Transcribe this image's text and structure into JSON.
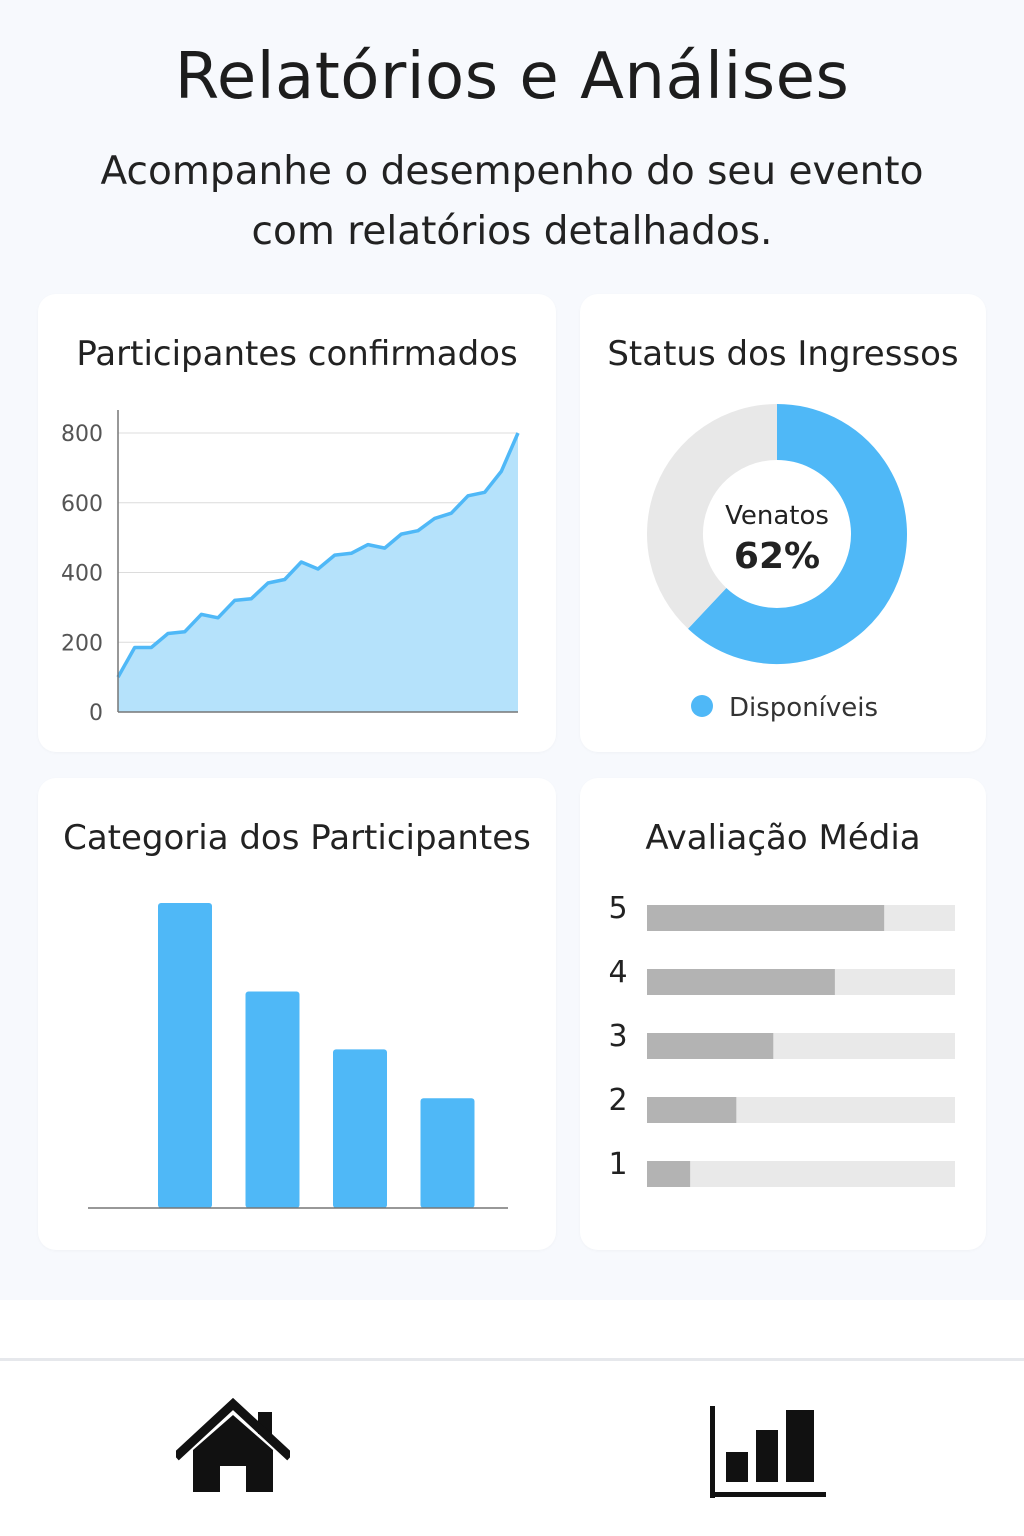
{
  "header": {
    "title": "Relatórios e Análises",
    "subtitle": "Acompanhe o desempenho do seu evento com relatórios detalhados."
  },
  "colors": {
    "accent": "#4fb8f7",
    "area_fill": "#b5e2fb",
    "donut_rest": "#e8e8e8",
    "rating_fill": "#b3b3b3",
    "rating_track": "#e9e9e9"
  },
  "participants_card": {
    "title": "Participantes confirmados"
  },
  "tickets_card": {
    "title": "Status dos Ingressos",
    "center_label": "Venatos",
    "center_value": "62%",
    "legend_label": "Disponíveis"
  },
  "category_card": {
    "title": "Categoria dos Participantes"
  },
  "rating_card": {
    "title": "Avaliação Média"
  },
  "bottom_nav": {
    "icons": [
      "home-icon",
      "bar-chart-icon"
    ]
  },
  "chart_data": [
    {
      "type": "area",
      "title": "Participantes confirmados",
      "ylim": [
        0,
        800
      ],
      "yticks": [
        0,
        200,
        400,
        600,
        800
      ],
      "x": [
        0,
        1,
        2,
        3,
        4,
        5,
        6,
        7,
        8,
        9,
        10,
        11,
        12,
        13,
        14,
        15,
        16,
        17,
        18,
        19,
        20,
        21,
        22,
        23,
        24
      ],
      "values": [
        100,
        185,
        185,
        225,
        230,
        280,
        270,
        320,
        325,
        370,
        380,
        430,
        410,
        450,
        455,
        480,
        470,
        510,
        520,
        555,
        570,
        620,
        630,
        690,
        800
      ],
      "grid": true
    },
    {
      "type": "pie",
      "donut": true,
      "slices": [
        {
          "label": "Venatos",
          "value": 62
        },
        {
          "label": "Disponíveis",
          "value": 38
        }
      ]
    },
    {
      "type": "bar",
      "categories": [
        "",
        "",
        "",
        ""
      ],
      "values": [
        100,
        71,
        52,
        36
      ],
      "ylim": [
        0,
        100
      ]
    },
    {
      "type": "bar",
      "orientation": "horizontal",
      "categories": [
        "5",
        "4",
        "3",
        "2",
        "1"
      ],
      "values": [
        77,
        61,
        41,
        29,
        14
      ],
      "xlim": [
        0,
        100
      ]
    }
  ]
}
